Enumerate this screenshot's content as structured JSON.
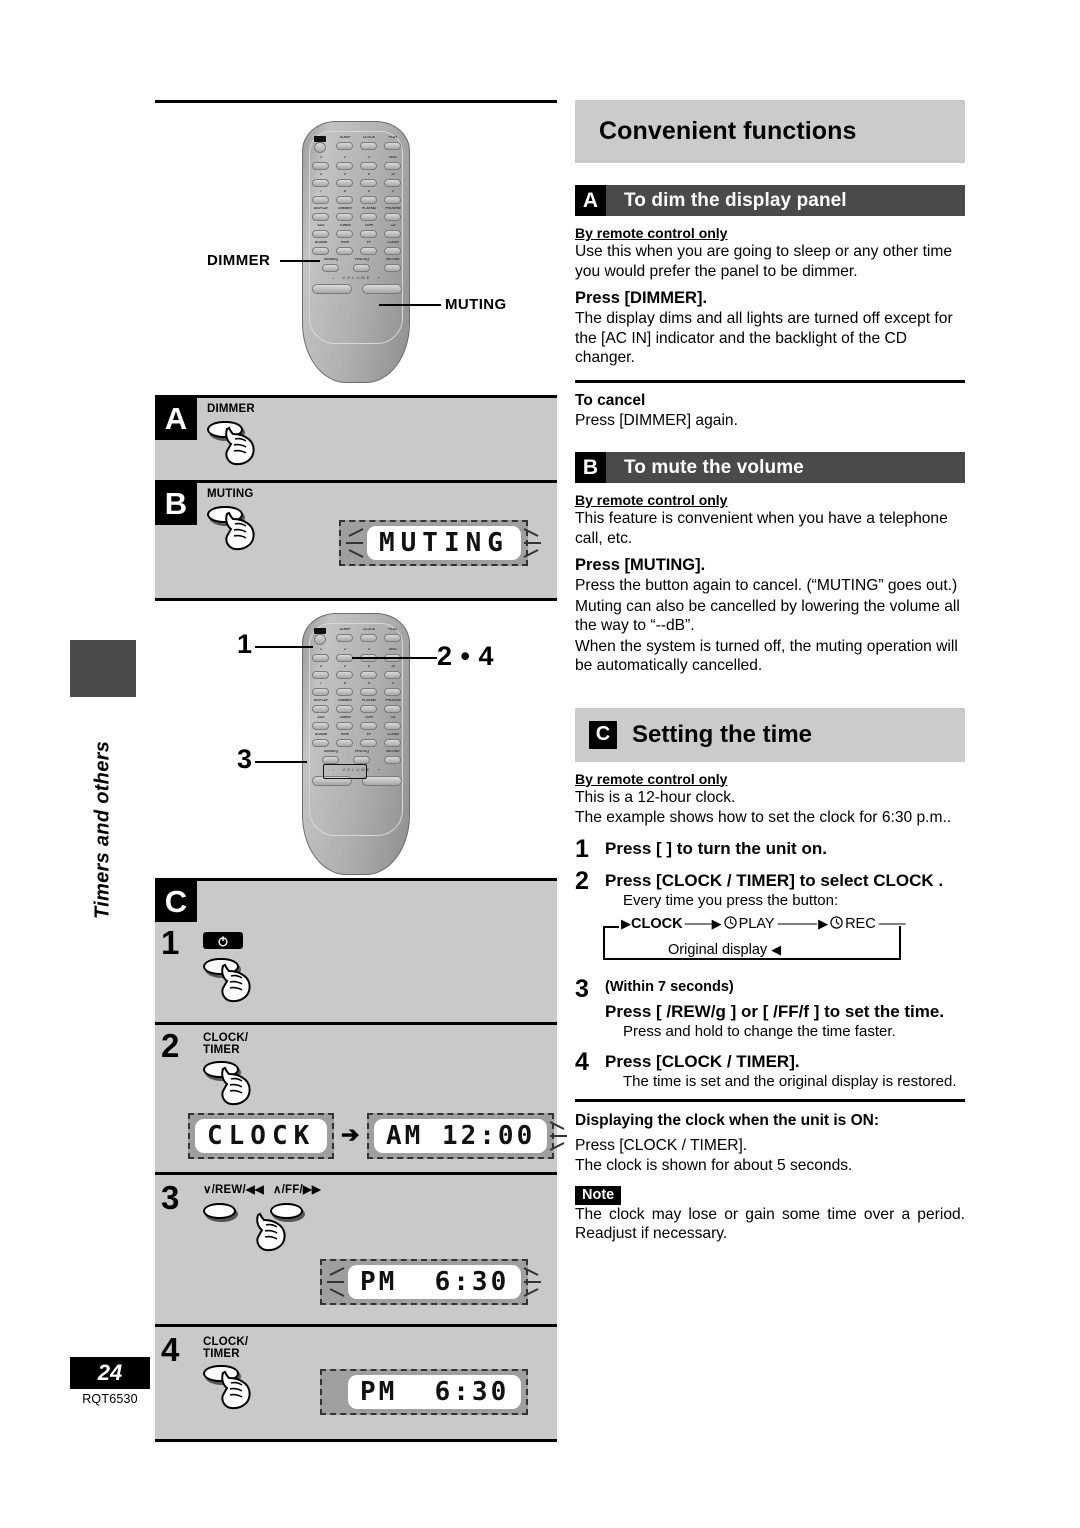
{
  "page": {
    "side_tab": "Timers and others",
    "page_number": "24",
    "doc_code": "RQT6530"
  },
  "title": "Convenient functions",
  "sections": [
    {
      "badge": "A",
      "heading": "To dim the display panel",
      "style": "dark",
      "intro_label": "By remote control only",
      "intro_text": "Use this when you are going to sleep or any other time you would prefer the panel to be dimmer.",
      "action": "Press [DIMMER].",
      "action_text": "The display dims and all lights are turned off except for the [AC IN] indicator and the backlight of the CD changer.",
      "cancel_label": "To cancel",
      "cancel_text": "Press [DIMMER] again."
    },
    {
      "badge": "B",
      "heading": "To mute the volume",
      "style": "dark",
      "intro_label": "By remote control only",
      "intro_text": "This feature is convenient when you have a telephone call, etc.",
      "action": "Press [MUTING].",
      "action_text_1": "Press the button again to cancel. (“MUTING” goes out.)",
      "action_text_2": "Muting can also be cancelled by lowering the volume all the way to “--dB”.",
      "action_text_3": "When the system is turned off, the muting operation will be automatically cancelled."
    }
  ],
  "section_c": {
    "badge": "C",
    "heading": "Setting the time",
    "intro_label": "By remote control only",
    "intro_1": "This is a 12-hour clock.",
    "intro_2": "The example shows how to set the clock for 6:30 p.m..",
    "steps": [
      {
        "n": "1",
        "head": "Press [  ] to turn the unit on.",
        "sub": ""
      },
      {
        "n": "2",
        "head": "Press [CLOCK / TIMER] to select  CLOCK .",
        "sub": "Every time you press the button:"
      },
      {
        "n": "3",
        "pre": "(Within 7 seconds)",
        "head": "Press [  /REW/g      ] or [   /FF/f       ] to set the time.",
        "sub": "Press and hold to change the time faster."
      },
      {
        "n": "4",
        "head": "Press [CLOCK / TIMER].",
        "sub": "The time is set and the original display is restored."
      }
    ],
    "cycle": {
      "item_1": "CLOCK",
      "item_2": "PLAY",
      "item_3": "REC",
      "return_label": "Original display",
      "clock_icon": "clock-icon"
    },
    "display_on_label": "Displaying the clock when the unit is ON:",
    "display_on_1": "Press [CLOCK / TIMER].",
    "display_on_2": "The clock is shown for about 5 seconds.",
    "note_tag": "Note",
    "note_text": "The clock may lose or gain some time over a period. Readjust if necessary."
  },
  "left_column": {
    "remote_top": {
      "callout_dimmer": "DIMMER",
      "callout_muting": "MUTING"
    },
    "remote_bottom": {
      "callout_1": "1",
      "callout_24": "2 • 4",
      "callout_3": "3"
    },
    "band_a": {
      "badge": "A",
      "button_label": "DIMMER"
    },
    "band_b": {
      "badge": "B",
      "button_label": "MUTING",
      "display": "MUTING"
    },
    "band_c": {
      "badge": "C"
    },
    "step1": {
      "n": "1",
      "button_label": "⏻"
    },
    "step2": {
      "n": "2",
      "button_label": "CLOCK/\nTIMER",
      "display_1": "CLOCK",
      "display_2": "AM 12:00"
    },
    "step3": {
      "n": "3",
      "button_label_left": "∨/REW/◀◀",
      "button_label_right": "∧/FF/▶▶",
      "display": "PM  6:30"
    },
    "step4": {
      "n": "4",
      "button_label": "CLOCK/\nTIMER",
      "display": "PM  6:30"
    }
  },
  "remote_keys": {
    "row_labels_1": [
      "",
      "SLEEP",
      "CLOCK/",
      "PLAY"
    ],
    "row_labels_1b": [
      "",
      "AUTO OFF",
      "TIMER",
      "REC"
    ],
    "row_labels_2": [
      "1",
      "2",
      "3",
      "DISC"
    ],
    "row_labels_3": [
      "4",
      "5",
      "6",
      "10"
    ],
    "row_labels_4": [
      "7",
      "8",
      "9",
      "0"
    ],
    "row_labels_5": [
      "DISPLAY",
      "DIMMER",
      "PLAY MODE",
      "PROGRAM"
    ],
    "row_labels_6": [
      "AUX",
      "TUNER",
      "TAPE",
      "CD"
    ],
    "row_labels_7": [
      "ALBUM",
      "REW",
      "FF",
      "CLEAR"
    ],
    "row_labels_8": [
      "S.SOUND EQ",
      "PRESET EQ",
      "MUTING"
    ],
    "volume_label": "VOLUME",
    "volume_minus": "−",
    "volume_plus": "+"
  },
  "colors": {
    "bar_dark": "#4a4a4a",
    "bar_light": "#cbcbcb",
    "band_gray": "#c9c9c9",
    "badge_black": "#000000"
  }
}
